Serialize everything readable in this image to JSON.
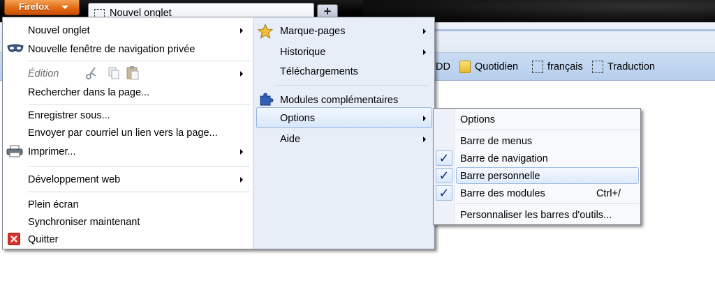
{
  "titlebar": {
    "firefox_button_label": "Firefox",
    "tab_title": "Nouvel onglet",
    "new_tab_symbol": "+"
  },
  "bookmarks_bar": {
    "items": [
      {
        "label": "DD",
        "icon": "none"
      },
      {
        "label": "Quotidien",
        "icon": "folder-icon"
      },
      {
        "label": "français",
        "icon": "page-icon"
      },
      {
        "label": "Traduction",
        "icon": "page-icon"
      }
    ]
  },
  "main_menu": {
    "left": {
      "new_tab": "Nouvel onglet",
      "private_window": "Nouvelle fenêtre de navigation privée",
      "edit": "Édition",
      "find_in_page": "Rechercher dans la page...",
      "save_as": "Enregistrer sous...",
      "send_link": "Envoyer par courriel un lien vers la page...",
      "print": "Imprimer...",
      "web_developer": "Développement web",
      "full_screen": "Plein écran",
      "sync_now": "Synchroniser maintenant",
      "quit": "Quitter"
    },
    "right": {
      "bookmarks": "Marque-pages",
      "history": "Historique",
      "downloads": "Téléchargements",
      "addons": "Modules complémentaires",
      "options": "Options",
      "help": "Aide"
    }
  },
  "options_submenu": {
    "options": "Options",
    "menu_bar": "Barre de menus",
    "nav_bar": "Barre de navigation",
    "bookmarks_toolbar": "Barre personnelle",
    "addon_bar": "Barre des modules",
    "addon_bar_shortcut": "Ctrl+/",
    "customize": "Personnaliser les barres d'outils...",
    "check_mark": "✓"
  }
}
